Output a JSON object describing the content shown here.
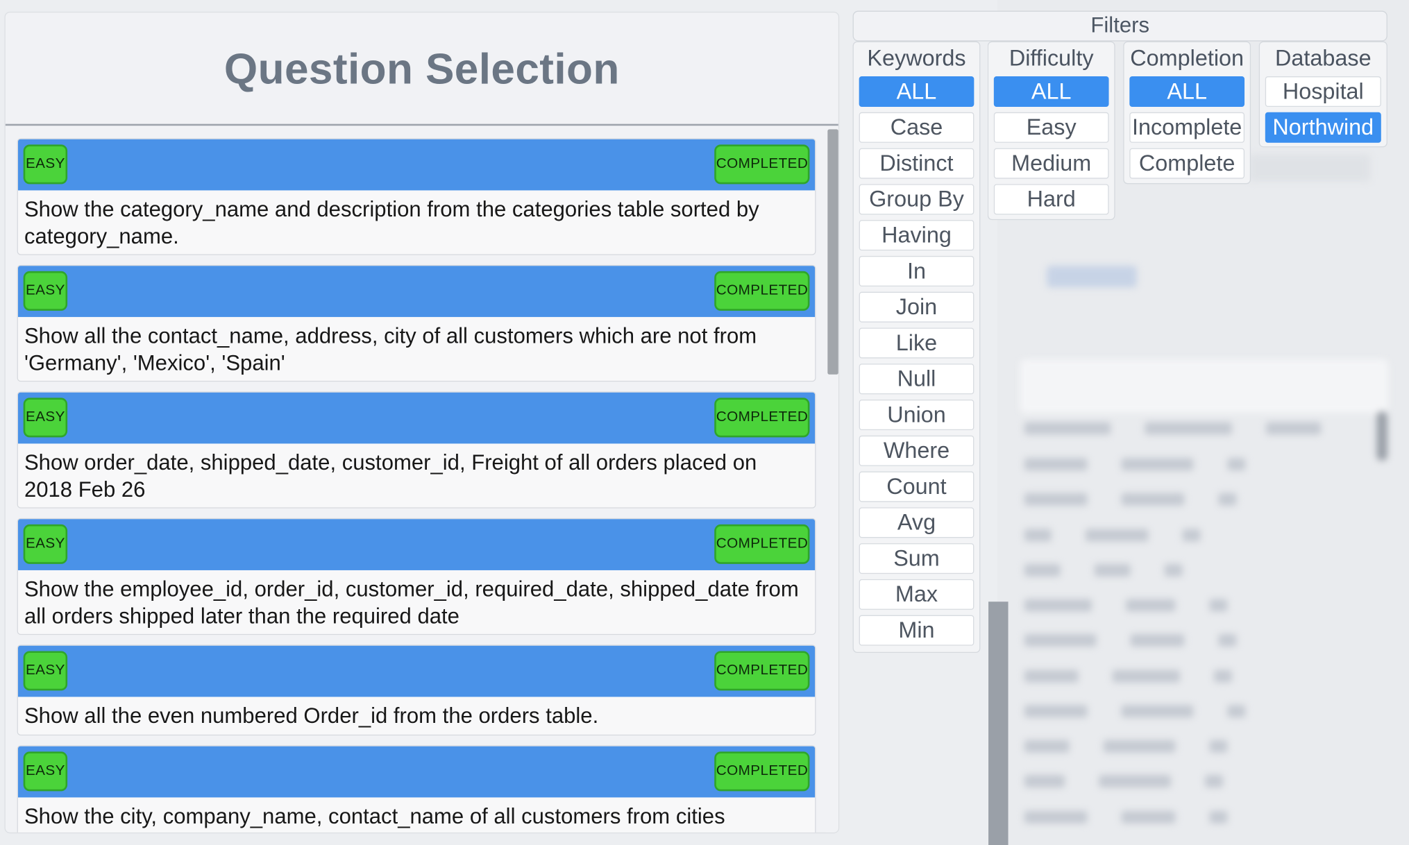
{
  "question_panel": {
    "title": "Question Selection",
    "questions": [
      {
        "difficulty": "EASY",
        "status": "COMPLETED",
        "text": "Show the category_name and description from the categories table sorted by category_name."
      },
      {
        "difficulty": "EASY",
        "status": "COMPLETED",
        "text": "Show all the contact_name, address, city of all customers which are not from 'Germany', 'Mexico', 'Spain'"
      },
      {
        "difficulty": "EASY",
        "status": "COMPLETED",
        "text": "Show order_date, shipped_date, customer_id, Freight of all orders placed on 2018 Feb 26"
      },
      {
        "difficulty": "EASY",
        "status": "COMPLETED",
        "text": "Show the employee_id, order_id, customer_id, required_date, shipped_date from all orders shipped later than the required date"
      },
      {
        "difficulty": "EASY",
        "status": "COMPLETED",
        "text": "Show all the even numbered Order_id from the orders table."
      },
      {
        "difficulty": "EASY",
        "status": "COMPLETED",
        "text": "Show the city, company_name, contact_name of all customers from cities"
      }
    ]
  },
  "filters": {
    "title": "Filters",
    "keywords": {
      "title": "Keywords",
      "options": [
        "ALL",
        "Case",
        "Distinct",
        "Group By",
        "Having",
        "In",
        "Join",
        "Like",
        "Null",
        "Union",
        "Where",
        "Count",
        "Avg",
        "Sum",
        "Max",
        "Min"
      ],
      "selected": "ALL"
    },
    "difficulty": {
      "title": "Difficulty",
      "options": [
        "ALL",
        "Easy",
        "Medium",
        "Hard"
      ],
      "selected": "ALL"
    },
    "completion": {
      "title": "Completion",
      "options": [
        "ALL",
        "Incomplete",
        "Complete"
      ],
      "selected": "ALL"
    },
    "database": {
      "title": "Database",
      "options": [
        "Hospital",
        "Northwind"
      ],
      "selected": "Northwind"
    }
  },
  "colors": {
    "card_header": "#4a92e8",
    "badge": "#4bd33a",
    "active_filter": "#3a8ff0"
  }
}
